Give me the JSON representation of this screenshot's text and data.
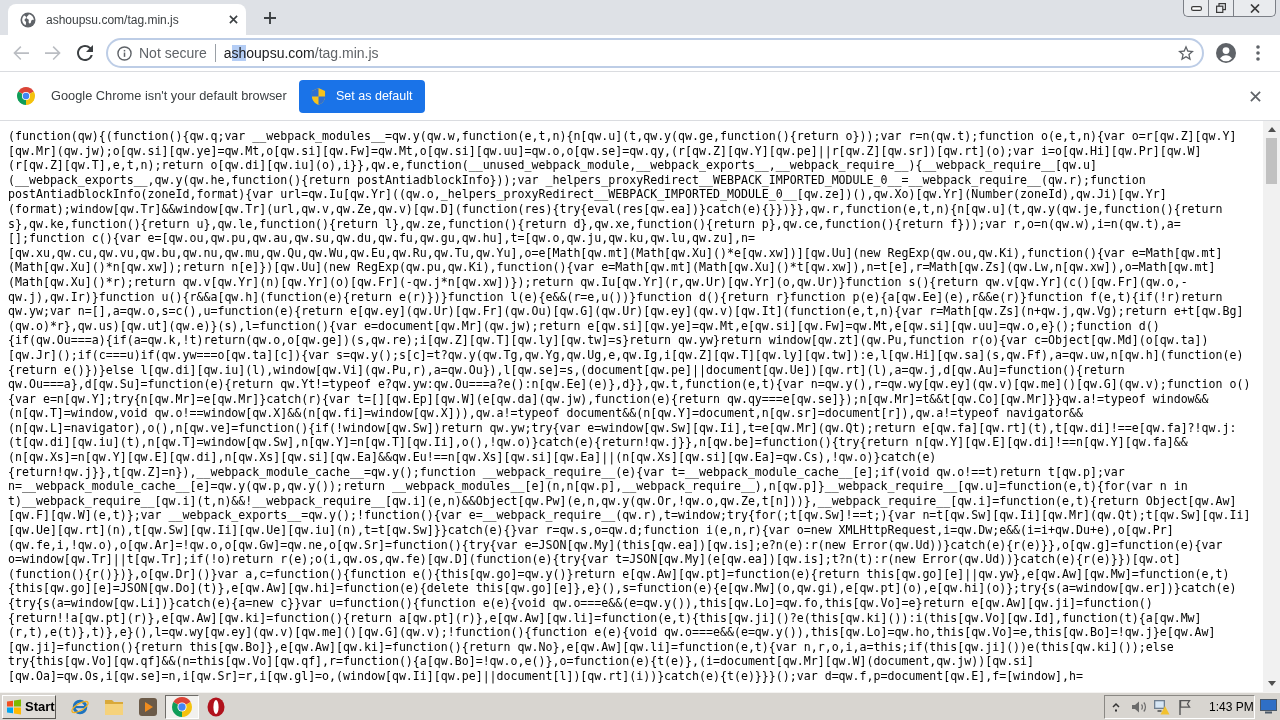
{
  "tabs": [
    {
      "title": "ashoupsu.com/tag.min.js",
      "selected": true
    }
  ],
  "nav": [
    {
      "kind": "back",
      "disabled": true
    },
    {
      "kind": "forward",
      "disabled": true
    },
    {
      "kind": "reload",
      "disabled": false
    }
  ],
  "toolbar": {
    "security_label": "Not secure",
    "url": [
      {
        "text": "a",
        "kind": "host",
        "selected": false
      },
      {
        "text": "sh",
        "kind": "host",
        "selected": true
      },
      {
        "text": "oupsu.com",
        "kind": "host",
        "selected": false
      },
      {
        "text": "/tag.min.js",
        "kind": "path",
        "selected": false
      }
    ]
  },
  "infobar": {
    "message": "Google Chrome isn't your default browser",
    "button": "Set as default"
  },
  "document": {
    "lines": [
      "(function(qw){(function(){qw.q;var __webpack_modules__=qw.y(qw.w,function(e,t,n){n[qw.u](t,qw.y(qw.ge,function(){return o}));var r=n(qw.t);function o(e,t,n){var o=r[qw.Z][qw.Y]",
      "[qw.Mr](qw.jw);o[qw.si][qw.ye]=qw.Mt,o[qw.si][qw.Fw]=qw.Mt,o[qw.si][qw.uu]=qw.o,o[qw.se]=qw.qy,(r[qw.Z][qw.Y][qw.pe]||r[qw.Z][qw.sr])[qw.rt](o);var i=o[qw.Hi][qw.Pr][qw.W]",
      "(r[qw.Z][qw.T],e,t,n);return o[qw.di][qw.iu](o),i}},qw.e,function(__unused_webpack_module,__webpack_exports__,__webpack_require__){__webpack_require__[qw.u]",
      "(__webpack_exports__,qw.y(qw.he,function(){return postAntiadblockInfo}));var _helpers_proxyRedirect__WEBPACK_IMPORTED_MODULE_0__=__webpack_require__(qw.r);function",
      "postAntiadblockInfo(zoneId,format){var url=qw.Iu[qw.Yr]((qw.o,_helpers_proxyRedirect__WEBPACK_IMPORTED_MODULE_0__[qw.ze])(),qw.Xo)[qw.Yr](Number(zoneId),qw.Ji)[qw.Yr]",
      "(format);window[qw.Tr]&&window[qw.Tr](url,qw.v,qw.Ze,qw.v)[qw.D](function(res){try{eval(res[qw.ea])}catch(e){}})}},qw.r,function(e,t,n){n[qw.u](t,qw.y(qw.je,function(){return",
      "s},qw.ke,function(){return u},qw.le,function(){return l},qw.ze,function(){return d},qw.xe,function(){return p},qw.ce,function(){return f}));var r,o=n(qw.w),i=n(qw.t),a=",
      "[];function c(){var e=[qw.ou,qw.pu,qw.au,qw.su,qw.du,qw.fu,qw.gu,qw.hu],t=[qw.o,qw.ju,qw.ku,qw.lu,qw.zu],n=",
      "[qw.xu,qw.cu,qw.vu,qw.bu,qw.nu,qw.mu,qw.Qu,qw.Wu,qw.Eu,qw.Ru,qw.Tu,qw.Yu],o=e[Math[qw.mt](Math[qw.Xu]()*e[qw.xw])][qw.Uu](new RegExp(qw.ou,qw.Ki),function(){var e=Math[qw.mt]",
      "(Math[qw.Xu]()*n[qw.xw]);return n[e]})[qw.Uu](new RegExp(qw.pu,qw.Ki),function(){var e=Math[qw.mt](Math[qw.Xu]()*t[qw.xw]),n=t[e],r=Math[qw.Zs](qw.Lw,n[qw.xw]),o=Math[qw.mt]",
      "(Math[qw.Xu]()*r);return qw.v[qw.Yr](n)[qw.Yr](o)[qw.Fr](-qw.j*n[qw.xw])});return qw.Iu[qw.Yr](r,qw.Ur)[qw.Yr](o,qw.Ur)}function s(){return qw.v[qw.Yr](c()[qw.Fr](qw.o,-",
      "qw.j),qw.Ir)}function u(){r&&a[qw.h](function(e){return e(r)})}function l(e){e&&(r=e,u())}function d(){return r}function p(e){a[qw.Ee](e),r&&e(r)}function f(e,t){if(!r)return",
      "qw.yw;var n=[],a=qw.o,s=c(),u=function(e){return e[qw.ey](qw.Ur)[qw.Fr](qw.Ou)[qw.G](qw.Ur)[qw.ey](qw.v)[qw.It](function(e,t,n){var r=Math[qw.Zs](n+qw.j,qw.Vg);return e+t[qw.Bg]",
      "(qw.o)*r},qw.us)[qw.ut](qw.e)}(s),l=function(){var e=document[qw.Mr](qw.jw);return e[qw.si][qw.ye]=qw.Mt,e[qw.si][qw.Fw]=qw.Mt,e[qw.si][qw.uu]=qw.o,e}();function d()",
      "{if(qw.Ou===a){if(a=qw.k,!t)return(qw.o,o[qw.ge])(s,qw.re);i[qw.Z][qw.T][qw.ly][qw.tw]=s}return qw.yw}return window[qw.zt](qw.Pu,function r(o){var c=Object[qw.Md](o[qw.ta])",
      "[qw.Jr]();if(c===u)if(qw.yw===o[qw.ta][c]){var s=qw.y();s[c]=t?qw.y(qw.Tg,qw.Yg,qw.Ug,e,qw.Ig,i[qw.Z][qw.T][qw.ly][qw.tw]):e,l[qw.Hi][qw.sa](s,qw.Ff),a=qw.uw,n[qw.h](function(e)",
      "{return e()})}else l[qw.di][qw.iu](l),window[qw.Vi](qw.Pu,r),a=qw.Ou}),l[qw.se]=s,(document[qw.pe]||document[qw.Ue])[qw.rt](l),a=qw.j,d[qw.Au]=function(){return",
      "qw.Ou===a},d[qw.Su]=function(e){return qw.Yt!=typeof e?qw.yw:qw.Ou===a?e():n[qw.Ee](e)},d}},qw.t,function(e,t){var n=qw.y(),r=qw.wy[qw.ey](qw.v)[qw.me]()[qw.G](qw.v);function o()",
      "{var e=n[qw.Y];try{n[qw.Mr]=e[qw.Mr]}catch(r){var t=[][qw.Ep][qw.W](e[qw.da](qw.jw),function(e){return qw.qy===e[qw.se]});n[qw.Mr]=t&&t[qw.Co][qw.Mr]}}qw.a!=typeof window&&",
      "(n[qw.T]=window,void qw.o!==window[qw.X]&&(n[qw.fi]=window[qw.X])),qw.a!=typeof document&&(n[qw.Y]=document,n[qw.sr]=document[r]),qw.a!=typeof navigator&&",
      "(n[qw.L]=navigator),o(),n[qw.ve]=function(){if(!window[qw.Sw])return qw.yw;try{var e=window[qw.Sw][qw.Ii],t=e[qw.Mr](qw.Qt);return e[qw.fa][qw.rt](t),t[qw.di]!==e[qw.fa]?!qw.j:",
      "(t[qw.di][qw.iu](t),n[qw.T]=window[qw.Sw],n[qw.Y]=n[qw.T][qw.Ii],o(),!qw.o)}catch(e){return!qw.j}},n[qw.be]=function(){try{return n[qw.Y][qw.E][qw.di]!==n[qw.Y][qw.fa]&&",
      "(n[qw.Xs]=n[qw.Y][qw.E][qw.di],n[qw.Xs][qw.si][qw.Ea]&&qw.Eu!==n[qw.Xs][qw.si][qw.Ea]||(n[qw.Xs][qw.si][qw.Ea]=qw.Cs),!qw.o)}catch(e)",
      "{return!qw.j}},t[qw.Z]=n}),__webpack_module_cache__=qw.y();function __webpack_require__(e){var t=__webpack_module_cache__[e];if(void qw.o!==t)return t[qw.p];var",
      "n=__webpack_module_cache__[e]=qw.y(qw.p,qw.y());return __webpack_modules__[e](n,n[qw.p],__webpack_require__),n[qw.p]}__webpack_require__[qw.u]=function(e,t){for(var n in",
      "t)__webpack_require__[qw.i](t,n)&&!__webpack_require__[qw.i](e,n)&&Object[qw.Pw](e,n,qw.y(qw.Or,!qw.o,qw.Ze,t[n]))},__webpack_require__[qw.i]=function(e,t){return Object[qw.Aw]",
      "[qw.F][qw.W](e,t)};var __webpack_exports__=qw.y();!function(){var e=__webpack_require__(qw.r),t=window;try{for(;t[qw.Sw]!==t;){var n=t[qw.Sw][qw.Ii][qw.Mr](qw.Qt);t[qw.Sw][qw.Ii]",
      "[qw.Ue][qw.rt](n),t[qw.Sw][qw.Ii][qw.Ue][qw.iu](n),t=t[qw.Sw]}}catch(e){}var r=qw.s,o=qw.d;function i(e,n,r){var o=new XMLHttpRequest,i=qw.Dw;e&&(i=i+qw.Du+e),o[qw.Pr]",
      "(qw.fe,i,!qw.o),o[qw.Ar]=!qw.o,o[qw.Gw]=qw.ne,o[qw.Sr]=function(){try{var e=JSON[qw.My](this[qw.ea])[qw.is];e?n(e):r(new Error(qw.Ud))}catch(e){r(e)}},o[qw.g]=function(e){var",
      "o=window[qw.Tr]||t[qw.Tr];if(!o)return r(e);o(i,qw.os,qw.fe)[qw.D](function(e){try{var t=JSON[qw.My](e[qw.ea])[qw.is];t?n(t):r(new Error(qw.Ud))}catch(e){r(e)}})[qw.ot]",
      "(function(){r()})},o[qw.Dr]()}var a,c=function(){function e(){this[qw.go]=qw.y()}return e[qw.Aw][qw.pt]=function(e){return this[qw.go][e]||qw.yw},e[qw.Aw][qw.Mw]=function(e,t)",
      "{this[qw.go][e]=JSON[qw.Do](t)},e[qw.Aw][qw.hi]=function(e){delete this[qw.go][e]},e}(),s=function(e){e[qw.Mw](o,qw.gi),e[qw.pt](o),e[qw.hi](o)};try{s(a=window[qw.er])}catch(e)",
      "{try{s(a=window[qw.Li])}catch(e){a=new c}}var u=function(){function e(e){void qw.o===e&&(e=qw.y()),this[qw.Lo]=qw.fo,this[qw.Vo]=e}return e[qw.Aw][qw.ji]=function()",
      "{return!!a[qw.pt](r)},e[qw.Aw][qw.ki]=function(){return a[qw.pt](r)},e[qw.Aw][qw.li]=function(e,t){this[qw.ji]()?e(this[qw.ki]()):i(this[qw.Vo][qw.Id],function(t){a[qw.Mw]",
      "(r,t),e(t)},t)},e}(),l=qw.wy[qw.ey](qw.v)[qw.me]()[qw.G](qw.v);!function(){function e(e){void qw.o===e&&(e=qw.y()),this[qw.Lo]=qw.ho,this[qw.Vo]=e,this[qw.Bo]=!qw.j}e[qw.Aw]",
      "[qw.ji]=function(){return this[qw.Bo]},e[qw.Aw][qw.ki]=function(){return qw.No},e[qw.Aw][qw.li]=function(e,t){var n,r,o,i,a=this;if(this[qw.ji]())e(this[qw.ki]());else",
      "try{this[qw.Vo][qw.qf]&&(n=this[qw.Vo][qw.qf],r=function(){a[qw.Bo]=!qw.o,e()},o=function(e){t(e)},(i=document[qw.Mr][qw.W](document,qw.jw))[qw.si]",
      "[qw.Oa]=qw.Os,i[qw.se]=n,i[qw.Sr]=r,i[qw.gl]=o,(window[qw.Ii][qw.pe]||document[l])[qw.rt](i))}catch(e){t(e)}}}();var d=qw.f,p=document[qw.E],f=[window],h="
    ]
  },
  "taskbar": {
    "start": "Start",
    "apps": [
      {
        "kind": "globe",
        "selected": false
      },
      {
        "kind": "folder",
        "selected": false
      },
      {
        "kind": "player",
        "selected": false
      },
      {
        "kind": "browser",
        "selected": true
      },
      {
        "kind": "ring",
        "selected": false
      }
    ],
    "clock": "1:43 PM"
  }
}
